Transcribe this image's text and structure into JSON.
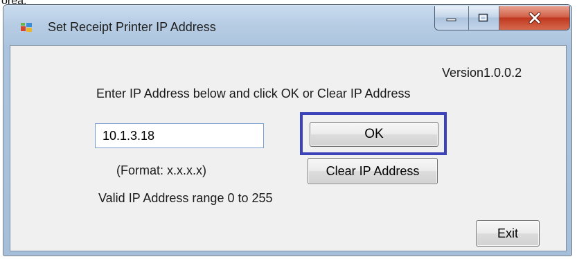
{
  "background": {
    "text": "orea."
  },
  "window": {
    "title": "Set Receipt Printer IP Address",
    "icon": "app-window-icon",
    "caption_buttons": [
      "minimize-icon",
      "maximize-icon",
      "close-icon"
    ]
  },
  "form": {
    "version": "Version1.0.0.2",
    "instructions": "Enter IP Address below and click OK or Clear IP Address",
    "ip_value": "10.1.3.18",
    "format_hint": "(Format: x.x.x.x)",
    "ok_label": "OK",
    "clear_label": "Clear IP Address",
    "valid_range": "Valid IP Address range 0 to 255",
    "exit_label": "Exit"
  },
  "colors": {
    "highlight_border": "#3c42b8",
    "close_button": "#c0381f",
    "titlebar": "#b7cde4"
  }
}
